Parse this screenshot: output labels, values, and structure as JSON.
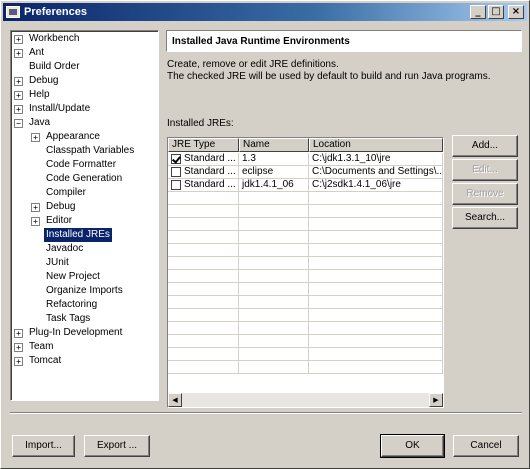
{
  "window": {
    "title": "Preferences",
    "controls": {
      "minimize": "_",
      "maximize": "□",
      "close": "×"
    }
  },
  "tree": [
    {
      "label": "Workbench",
      "expander": "+",
      "level": 0
    },
    {
      "label": "Ant",
      "expander": "+",
      "level": 0
    },
    {
      "label": "Build Order",
      "expander": "",
      "level": 0
    },
    {
      "label": "Debug",
      "expander": "+",
      "level": 0
    },
    {
      "label": "Help",
      "expander": "+",
      "level": 0
    },
    {
      "label": "Install/Update",
      "expander": "+",
      "level": 0
    },
    {
      "label": "Java",
      "expander": "−",
      "level": 0
    },
    {
      "label": "Appearance",
      "expander": "+",
      "level": 1
    },
    {
      "label": "Classpath Variables",
      "expander": "",
      "level": 1
    },
    {
      "label": "Code Formatter",
      "expander": "",
      "level": 1
    },
    {
      "label": "Code Generation",
      "expander": "",
      "level": 1
    },
    {
      "label": "Compiler",
      "expander": "",
      "level": 1
    },
    {
      "label": "Debug",
      "expander": "+",
      "level": 1
    },
    {
      "label": "Editor",
      "expander": "+",
      "level": 1
    },
    {
      "label": "Installed JREs",
      "expander": "",
      "level": 1,
      "selected": true
    },
    {
      "label": "Javadoc",
      "expander": "",
      "level": 1
    },
    {
      "label": "JUnit",
      "expander": "",
      "level": 1
    },
    {
      "label": "New Project",
      "expander": "",
      "level": 1
    },
    {
      "label": "Organize Imports",
      "expander": "",
      "level": 1
    },
    {
      "label": "Refactoring",
      "expander": "",
      "level": 1
    },
    {
      "label": "Task Tags",
      "expander": "",
      "level": 1
    },
    {
      "label": "Plug-In Development",
      "expander": "+",
      "level": 0
    },
    {
      "label": "Team",
      "expander": "+",
      "level": 0
    },
    {
      "label": "Tomcat",
      "expander": "+",
      "level": 0
    }
  ],
  "page": {
    "title": "Installed Java Runtime Environments",
    "description_line1": "Create, remove or edit JRE definitions.",
    "description_line2": "The checked JRE will be used by default to build and run Java programs.",
    "list_label": "Installed JREs:"
  },
  "table": {
    "columns": [
      "JRE Type",
      "Name",
      "Location"
    ],
    "rows": [
      {
        "checked": true,
        "type": "Standard ...",
        "name": "1.3",
        "location": "C:\\jdk1.3.1_10\\jre"
      },
      {
        "checked": false,
        "type": "Standard ...",
        "name": "eclipse",
        "location": "C:\\Documents and Settings\\..."
      },
      {
        "checked": false,
        "type": "Standard ...",
        "name": "jdk1.4.1_06",
        "location": "C:\\j2sdk1.4.1_06\\jre"
      }
    ],
    "empty_rows": 14
  },
  "actions": {
    "add": "Add...",
    "edit": "Edit...",
    "remove": "Remove",
    "search": "Search..."
  },
  "footer": {
    "import": "Import...",
    "export": "Export ...",
    "ok": "OK",
    "cancel": "Cancel"
  },
  "colors": {
    "face": "#d4d0c8",
    "title_active": "#0a246a",
    "selection": "#0a246a"
  }
}
